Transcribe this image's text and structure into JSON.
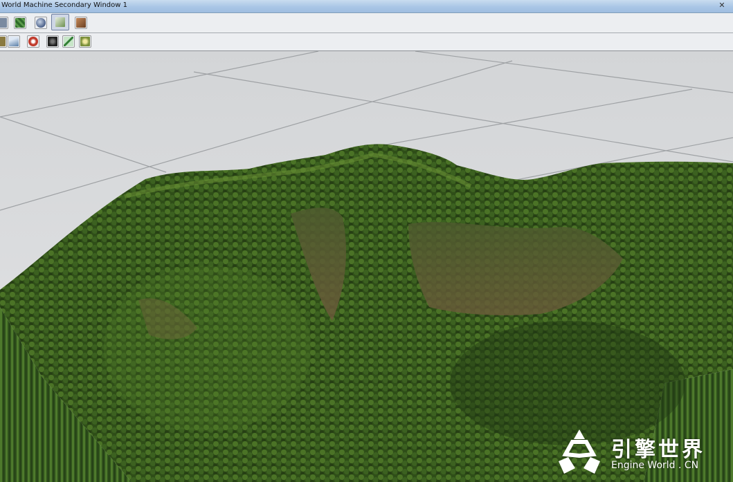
{
  "window": {
    "title": "World Machine Secondary Window 1",
    "close_glyph": "✕"
  },
  "toolbar_top": {
    "buttons": [
      {
        "icon": "render-icon",
        "color": "#7a8aa0",
        "active": false
      },
      {
        "icon": "texture-icon",
        "color": "#3f7a3a",
        "active": false
      },
      {
        "icon": "sphere-icon",
        "color": "#4a5f88",
        "active": false
      },
      {
        "icon": "3d-view-icon",
        "color": "#6c8f4f",
        "active": true
      },
      {
        "icon": "terrain-texture-icon",
        "color": "#8a5a3a",
        "active": false
      }
    ]
  },
  "toolbar_bottom": {
    "buttons": [
      {
        "icon": "tool-a-icon",
        "color": "#8a7a40"
      },
      {
        "icon": "mountain-icon",
        "color": "#5a7fa8"
      },
      {
        "icon": "red-filter-icon",
        "color": "#c0392b"
      },
      {
        "icon": "camera-icon",
        "color": "#2f2f2f"
      },
      {
        "icon": "brush-icon",
        "color": "#2e7d32"
      },
      {
        "icon": "settings-icon",
        "color": "#7a8f3a"
      }
    ]
  },
  "viewport": {
    "scene": "3D terrain preview",
    "ground_color": "#dcdddf",
    "grid_color": "#9ea1a4",
    "terrain_colors": [
      "#1f3512",
      "#2f4e18",
      "#3d6420",
      "#557a2c",
      "#6b5a3a"
    ]
  },
  "watermark": {
    "chinese": "引擎世界",
    "english": "Engine World . CN"
  }
}
